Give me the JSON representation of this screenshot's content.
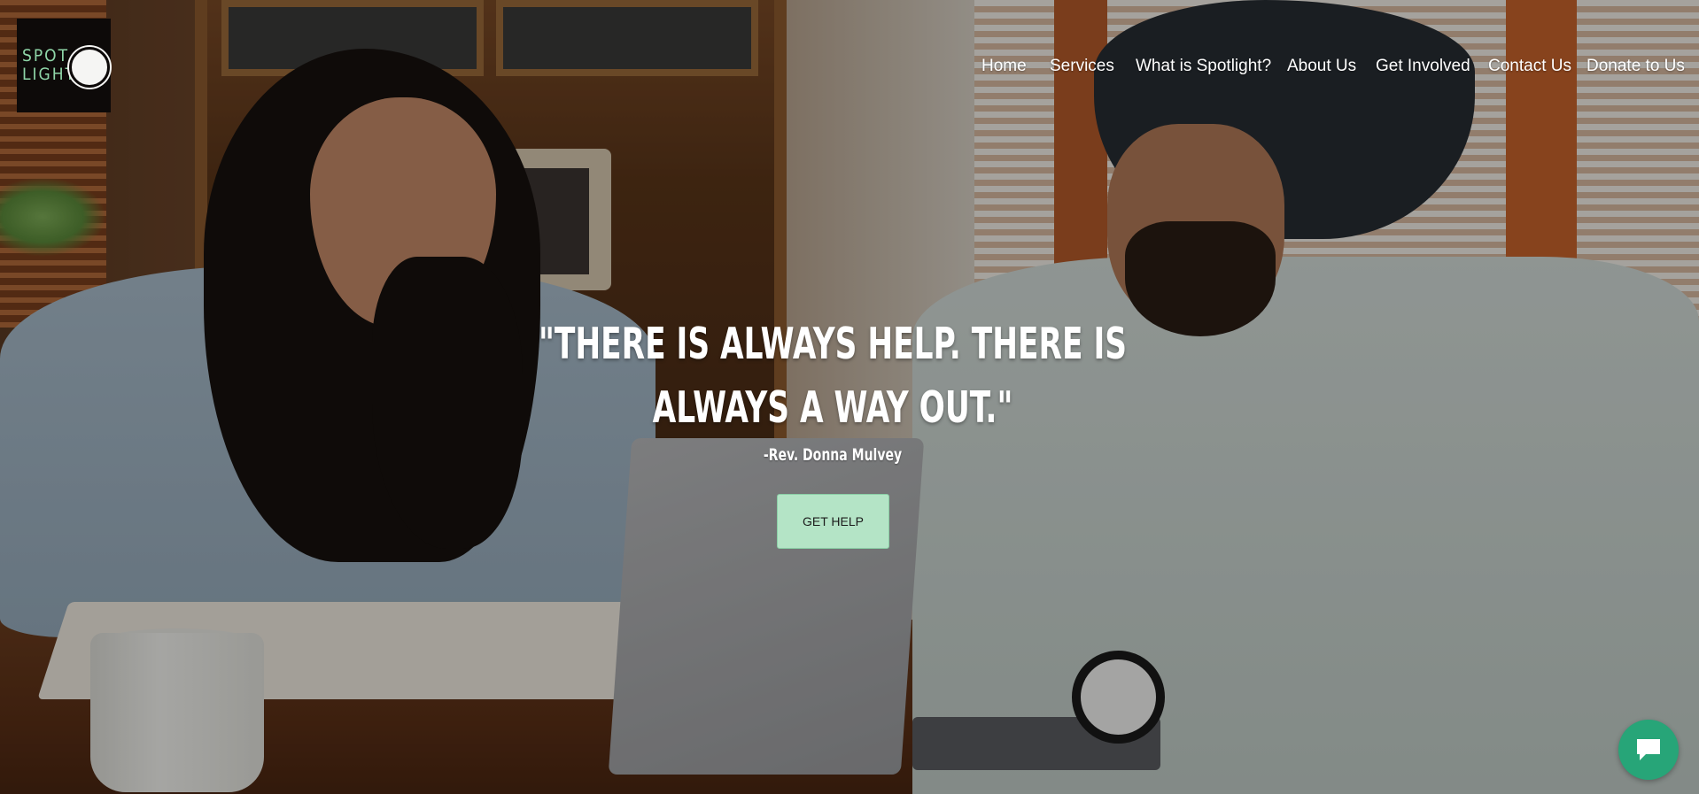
{
  "logo": {
    "line1": "SPOT",
    "line2": "LIGHT",
    "icon": "spotlight-circle-icon"
  },
  "nav": {
    "items": [
      {
        "label": "Home"
      },
      {
        "label": "Services"
      },
      {
        "label": "What is Spotlight?"
      },
      {
        "label": "About Us"
      },
      {
        "label": "Get Involved"
      },
      {
        "label": "Contact Us"
      },
      {
        "label": "Donate to Us"
      }
    ]
  },
  "hero": {
    "quote": "\"THERE IS ALWAYS HELP. THERE IS ALWAYS A WAY OUT.\"",
    "attribution": "-Rev. Donna Mulvey",
    "cta_label": "GET HELP"
  },
  "chat": {
    "icon": "chat-bubble-icon"
  },
  "colors": {
    "cta_background": "#b4e4c6",
    "chat_background": "#27a578",
    "logo_text": "#8fd6a8",
    "logo_background": "#0d0a09"
  }
}
